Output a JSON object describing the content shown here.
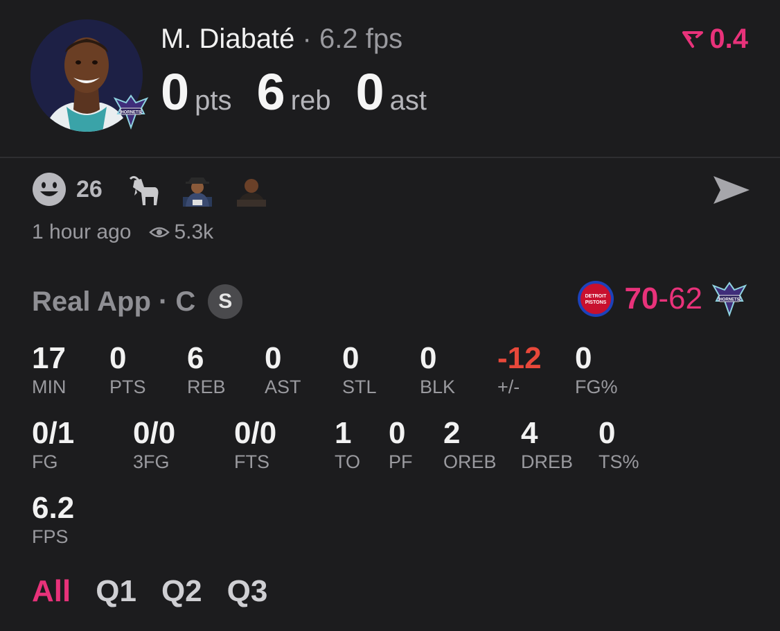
{
  "header": {
    "player_name": "M. Diabaté",
    "separator": "·",
    "fps_text": "6.2 fps",
    "trend_value": "0.4",
    "stats": [
      {
        "value": "0",
        "unit": "pts"
      },
      {
        "value": "6",
        "unit": "reb"
      },
      {
        "value": "0",
        "unit": "ast"
      }
    ]
  },
  "reactions": {
    "count": "26",
    "emojis": [
      "smiley-icon",
      "goat-icon",
      "person-sticker-1",
      "person-sticker-2"
    ],
    "time": "1 hour ago",
    "views": "5.3k"
  },
  "game": {
    "source": "Real App · C",
    "badge": "S",
    "home_logo_text": "DETROIT PISTONS",
    "away_logo_text": "HORNETS",
    "score_lead": "70",
    "score_dash": "-",
    "score_trail": "62"
  },
  "stats_row1": [
    {
      "value": "17",
      "label": "MIN"
    },
    {
      "value": "0",
      "label": "PTS"
    },
    {
      "value": "6",
      "label": "REB"
    },
    {
      "value": "0",
      "label": "AST"
    },
    {
      "value": "0",
      "label": "STL"
    },
    {
      "value": "0",
      "label": "BLK"
    },
    {
      "value": "-12",
      "label": "+/-"
    },
    {
      "value": "0",
      "label": "FG%"
    }
  ],
  "stats_row2": [
    {
      "value": "0/1",
      "label": "FG"
    },
    {
      "value": "0/0",
      "label": "3FG"
    },
    {
      "value": "0/0",
      "label": "FTS"
    },
    {
      "value": "1",
      "label": "TO"
    },
    {
      "value": "0",
      "label": "PF"
    },
    {
      "value": "2",
      "label": "OREB"
    },
    {
      "value": "4",
      "label": "DREB"
    },
    {
      "value": "0",
      "label": "TS%"
    }
  ],
  "stats_row3": [
    {
      "value": "6.2",
      "label": "FPS"
    }
  ],
  "tabs": [
    "All",
    "Q1",
    "Q2",
    "Q3"
  ],
  "colors": {
    "accent": "#e8327a",
    "negative": "#e8483a",
    "background": "#1c1c1e"
  }
}
